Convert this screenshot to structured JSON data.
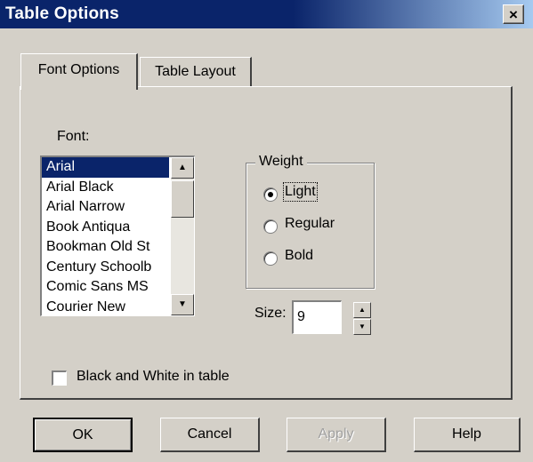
{
  "window": {
    "title": "Table Options",
    "close_label": "×"
  },
  "tabs": [
    {
      "label": "Font Options",
      "active": true
    },
    {
      "label": "Table Layout",
      "active": false
    }
  ],
  "font": {
    "label": "Font:",
    "items": [
      "Arial",
      "Arial Black",
      "Arial Narrow",
      "Book Antiqua",
      "Bookman Old St",
      "Century Schoolb",
      "Comic Sans MS",
      "Courier New"
    ],
    "selected": "Arial"
  },
  "weight": {
    "title": "Weight",
    "options": [
      "Light",
      "Regular",
      "Bold"
    ],
    "selected": "Light"
  },
  "size": {
    "label": "Size:",
    "value": "9"
  },
  "bw_checkbox": {
    "label": "Black and White in table",
    "checked": false
  },
  "buttons": {
    "ok": "OK",
    "cancel": "Cancel",
    "apply": "Apply",
    "help": "Help"
  },
  "icons": [
    "close-icon",
    "scroll-up-arrow-icon",
    "scroll-down-arrow-icon",
    "spin-up-icon",
    "spin-down-icon"
  ],
  "colors": {
    "title_bar": "#0a246a",
    "selection": "#0a246a",
    "face": "#d4d0c8"
  }
}
